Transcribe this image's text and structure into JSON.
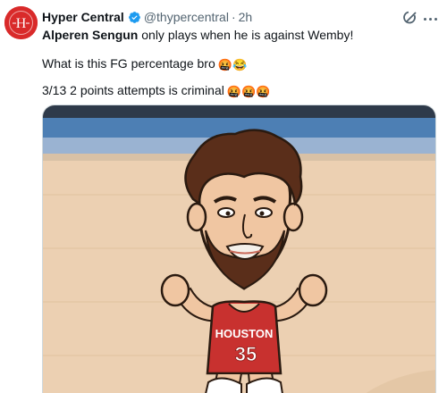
{
  "tweet": {
    "display_name": "Hyper Central",
    "handle": "@thypercentral",
    "dot": "·",
    "time": "2h",
    "mention": "Alperen Sengun",
    "line1_rest": " only plays when he is against Wemby!",
    "line2_text": "What is this FG percentage bro",
    "line2_emoji": "🤬😂",
    "line3_text": "3/13 2 points attempts is criminal",
    "line3_emoji": "🤬🤬🤬"
  },
  "media": {
    "jersey_text": "HOUSTON",
    "jersey_number": "35"
  },
  "icons": {
    "avatar_logo": "hyper-central-logo",
    "verified": "verified-badge-icon",
    "grok": "grok-icon",
    "more": "more-options-icon"
  },
  "colors": {
    "avatar_bg": "#d92a2a",
    "verified": "#1d9bf0",
    "secondary_text": "#536471",
    "court_floor": "#ecd0b2",
    "jersey_red": "#c8312f"
  }
}
